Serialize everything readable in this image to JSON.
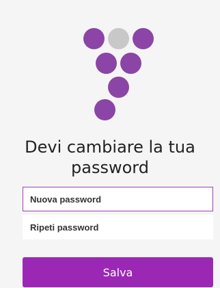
{
  "logo": {
    "icon": "grape-cluster-logo",
    "colors": {
      "purple": "#8b45a6",
      "gray": "#c8c8c8"
    }
  },
  "title": "Devi cambiare la tua password",
  "fields": {
    "new_password": {
      "placeholder": "Nuova password",
      "value": ""
    },
    "repeat_password": {
      "placeholder": "Ripeti password",
      "value": ""
    }
  },
  "actions": {
    "save_label": "Salva"
  },
  "theme": {
    "accent": "#9b28b5",
    "background": "#f5f5f5"
  }
}
